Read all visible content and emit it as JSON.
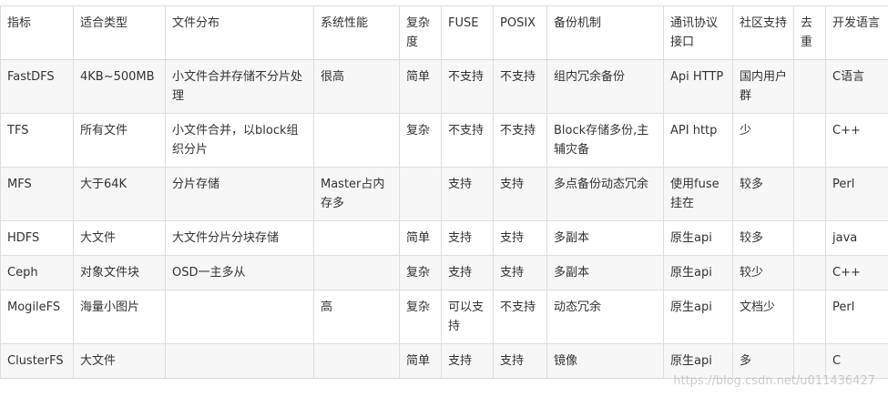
{
  "headers": [
    "指标",
    "适合类型",
    "文件分布",
    "系统性能",
    "复杂度",
    "FUSE",
    "POSIX",
    "备份机制",
    "通讯协议接口",
    "社区支持",
    "去重",
    "开发语言"
  ],
  "rows": [
    [
      "FastDFS",
      "4KB~500MB",
      "小文件合并存储不分片处理",
      "很高",
      "简单",
      "不支持",
      "不支持",
      "组内冗余备份",
      "Api HTTP",
      "国内用户群",
      "",
      "C语言"
    ],
    [
      "TFS",
      "所有文件",
      "小文件合并，以block组织分片",
      "",
      "复杂",
      "不支持",
      "不支持",
      "Block存储多份,主辅灾备",
      "API http",
      "少",
      "",
      "C++"
    ],
    [
      "MFS",
      "大于64K",
      "分片存储",
      "Master占内存多",
      "",
      "支持",
      "支持",
      "多点备份动态冗余",
      "使用fuse挂在",
      "较多",
      "",
      "Perl"
    ],
    [
      "HDFS",
      "大文件",
      "大文件分片分块存储",
      "",
      "简单",
      "支持",
      "支持",
      "多副本",
      "原生api",
      "较多",
      "",
      "java"
    ],
    [
      "Ceph",
      "对象文件块",
      "OSD一主多从",
      "",
      "复杂",
      "支持",
      "支持",
      "多副本",
      "原生api",
      "较少",
      "",
      "C++"
    ],
    [
      "MogileFS",
      "海量小图片",
      "",
      "高",
      "复杂",
      "可以支持",
      "不支持",
      "动态冗余",
      "原生api",
      "文档少",
      "",
      "Perl"
    ],
    [
      "ClusterFS",
      "大文件",
      "",
      "",
      "简单",
      "支持",
      "支持",
      "镜像",
      "原生api",
      "多",
      "",
      "C"
    ]
  ],
  "watermark": "https://blog.csdn.net/u011436427"
}
